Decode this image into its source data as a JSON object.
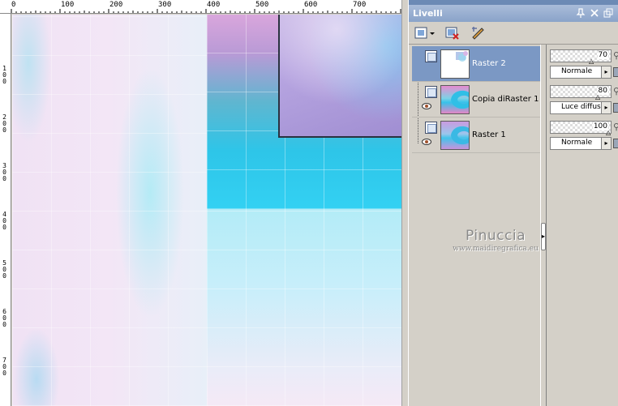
{
  "ruler": {
    "top_labels": [
      "0",
      "100",
      "200",
      "300",
      "400",
      "500",
      "600",
      "700"
    ],
    "left_labels": [
      "1 0 0",
      "2 0 0",
      "3 0 0",
      "4 0 0",
      "5 0 0",
      "6 0 0",
      "7 0 0"
    ]
  },
  "palette": {
    "title": "Livelli",
    "layers": [
      {
        "name": "Raster 2",
        "opacity": "70",
        "blend_mode": "Normale",
        "selected": true
      },
      {
        "name": "Copia diRaster 1",
        "opacity": "80",
        "blend_mode": "Luce diffusa",
        "selected": false
      },
      {
        "name": "Raster 1",
        "opacity": "100",
        "blend_mode": "Normale",
        "selected": false
      }
    ]
  },
  "watermark": {
    "name": "Pinuccia",
    "url": "www.maidiregrafica.eu"
  },
  "icons": {
    "new_layer": "new-layer-icon",
    "delete_layer": "delete-layer-icon",
    "edit_layer": "edit-layer-icon",
    "pin": "pin-icon",
    "close": "close-icon",
    "restore": "restore-icon",
    "eye": "eye-icon",
    "lock": "lock-icon",
    "link": "link-icon"
  }
}
